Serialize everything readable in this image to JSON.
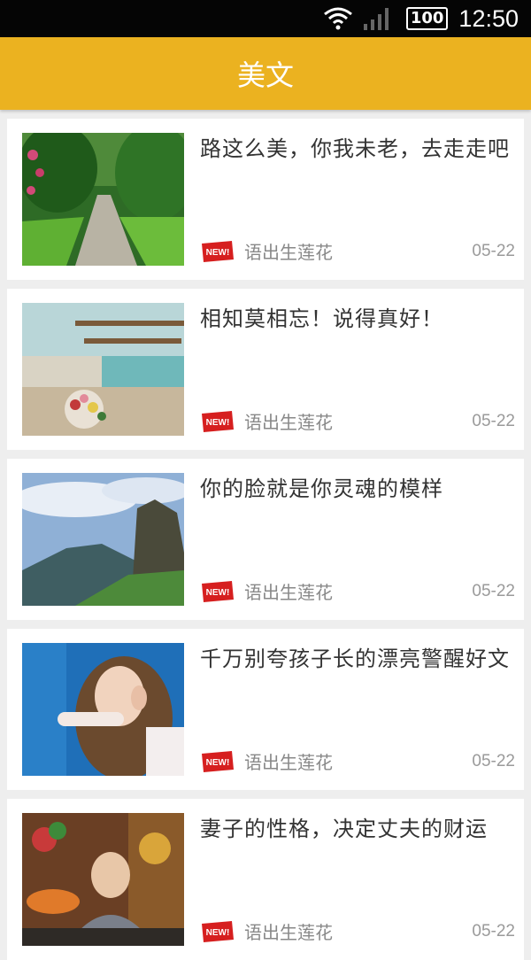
{
  "status_bar": {
    "battery": "100",
    "time": "12:50"
  },
  "app_bar": {
    "title": "美文"
  },
  "colors": {
    "accent": "#ebb220",
    "badge_red": "#d61f1f"
  },
  "articles": [
    {
      "title": "路这么美，你我未老，去走走吧",
      "badge": "NEW!",
      "author": "语出生莲花",
      "date": "05-22",
      "thumb_icon": "forest-path-photo"
    },
    {
      "title": "相知莫相忘！说得真好！",
      "badge": "NEW!",
      "author": "语出生莲花",
      "date": "05-22",
      "thumb_icon": "cafe-flowers-photo"
    },
    {
      "title": "你的脸就是你灵魂的模样",
      "badge": "NEW!",
      "author": "语出生莲花",
      "date": "05-22",
      "thumb_icon": "mountain-peak-photo"
    },
    {
      "title": "千万别夸孩子长的漂亮警醒好文",
      "badge": "NEW!",
      "author": "语出生莲花",
      "date": "05-22",
      "thumb_icon": "listening-girl-photo"
    },
    {
      "title": "妻子的性格，决定丈夫的财运",
      "badge": "NEW!",
      "author": "语出生莲花",
      "date": "05-22",
      "thumb_icon": "monk-portrait-photo"
    }
  ]
}
